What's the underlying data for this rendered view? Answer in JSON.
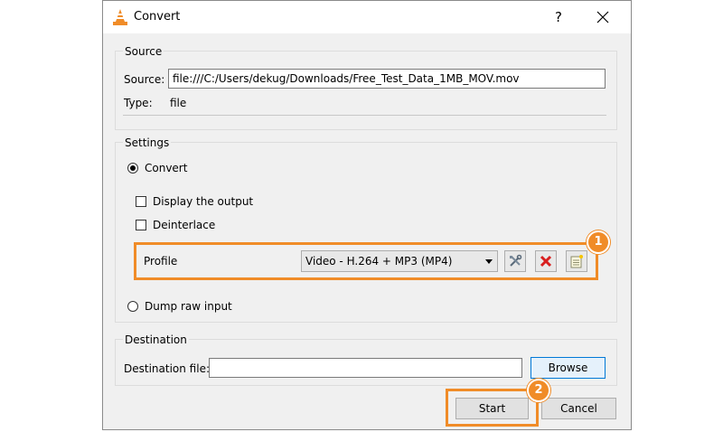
{
  "window": {
    "title": "Convert",
    "help_symbol": "?",
    "icon": "vlc-cone-icon"
  },
  "source": {
    "group_title": "Source",
    "source_label": "Source:",
    "source_value": "file:///C:/Users/dekug/Downloads/Free_Test_Data_1MB_MOV.mov",
    "type_label": "Type:",
    "type_value": "file"
  },
  "settings": {
    "group_title": "Settings",
    "convert_label": "Convert",
    "convert_selected": true,
    "display_output_label": "Display the output",
    "display_output_checked": false,
    "deinterlace_label": "Deinterlace",
    "deinterlace_checked": false,
    "profile_label": "Profile",
    "profile_selected": "Video - H.264 + MP3 (MP4)",
    "profile_tools": [
      "edit-profile-icon",
      "delete-profile-icon",
      "new-profile-icon"
    ],
    "dump_raw_label": "Dump raw input",
    "dump_raw_selected": false
  },
  "destination": {
    "group_title": "Destination",
    "dest_label": "Destination file:",
    "dest_value": "",
    "browse_label": "Browse"
  },
  "buttons": {
    "start_label": "Start",
    "cancel_label": "Cancel"
  },
  "annotations": {
    "step1": "1",
    "step2": "2",
    "highlight_color": "#f08c28"
  }
}
